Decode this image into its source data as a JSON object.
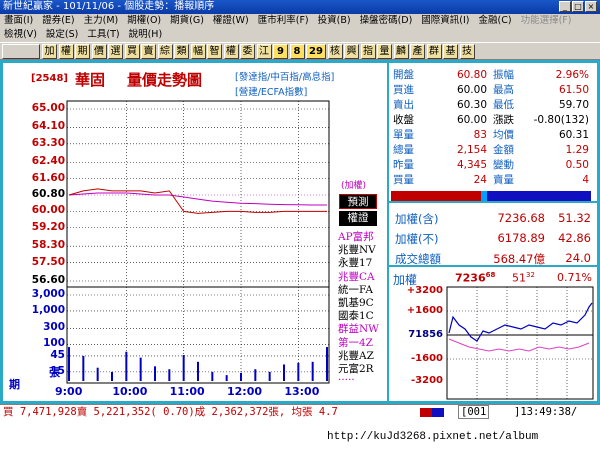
{
  "window": {
    "title": "新世紀贏家 - 101/11/06 - 個股走勢：播報順序"
  },
  "menu_row1": [
    "畫面(I)",
    "證券(E)",
    "主力(M)",
    "期權(O)",
    "期貨(G)",
    "權證(W)",
    "匯市利率(F)",
    "投資(B)",
    "操盤密碼(D)",
    "國際資訊(I)",
    "金融(C)",
    "功能選擇(F)"
  ],
  "menu_row2": [
    "檢視(V)",
    "設定(S)",
    "工具(T)",
    "說明(H)"
  ],
  "toolbar": [
    "加",
    "權",
    "期",
    "價",
    "選",
    "買",
    "賣",
    "綜",
    "類",
    "幅",
    "智",
    "權",
    "委",
    "江",
    "9",
    "8",
    "29",
    "核",
    "興",
    "指",
    "量",
    "麟",
    "產",
    "群",
    "基",
    "技"
  ],
  "stock": {
    "code": "[2548]",
    "name": "華固",
    "chart_title": "量價走勢圖",
    "index_links": "[發達指/中百指/高息指]",
    "index_links2": "[營建/ECFA指數]",
    "reference_tag": "(加權)"
  },
  "price_axis": [
    "65.00",
    "64.10",
    "63.30",
    "62.40",
    "61.60",
    "60.80",
    "60.00",
    "59.20",
    "58.30",
    "57.50",
    "56.60"
  ],
  "volume_axis": [
    "3,000",
    "1,000",
    "300",
    "100",
    "45",
    "15"
  ],
  "volume_label": "張",
  "period_label": "期",
  "time_axis": [
    "9:00",
    "10:00",
    "11:00",
    "12:00",
    "13:00"
  ],
  "legend_buttons": {
    "forecast": "預測",
    "warrant": "權證"
  },
  "brokers": [
    {
      "name": "AP富邦",
      "color": "#c000c0"
    },
    {
      "name": "兆豐NV",
      "color": "#000000"
    },
    {
      "name": "永豐17",
      "color": "#000000"
    },
    {
      "name": "兆豐CA",
      "color": "#c000c0"
    },
    {
      "name": "統一FA",
      "color": "#000000"
    },
    {
      "name": "凱基9C",
      "color": "#000000"
    },
    {
      "name": "國泰1C",
      "color": "#000000"
    },
    {
      "name": "群益NW",
      "color": "#c000c0"
    },
    {
      "name": "第一4Z",
      "color": "#c000c0"
    },
    {
      "name": "兆豐AZ",
      "color": "#000000"
    },
    {
      "name": "元富2R",
      "color": "#000000"
    },
    {
      "name": "·····",
      "color": "#c000c0"
    }
  ],
  "quote": [
    {
      "l1": "開盤",
      "v1": "60.80",
      "l2": "振幅",
      "v2": "2.96%",
      "c1": "#c00000",
      "c2": "#c00000"
    },
    {
      "l1": "買進",
      "v1": "60.00",
      "l2": "最高",
      "v2": "61.50",
      "c1": "#000000",
      "c2": "#c00000"
    },
    {
      "l1": "賣出",
      "v1": "60.30",
      "l2": "最低",
      "v2": "59.70",
      "c1": "#000000",
      "c2": "#000000"
    },
    {
      "l1": "收盤",
      "v1": "60.00",
      "l2": "漲跌",
      "v2": "-0.80(132)",
      "c1": "#000000",
      "c2": "#000000"
    },
    {
      "l1": "單量",
      "v1": "83",
      "l2": "均價",
      "v2": "60.31",
      "c1": "#c00000",
      "c2": "#000000"
    },
    {
      "l1": "總量",
      "v1": "2,154",
      "l2": "金額",
      "v2": "1.29",
      "c1": "#c00000",
      "c2": "#c00000"
    },
    {
      "l1": "昨量",
      "v1": "4,345",
      "l2": "變動",
      "v2": "0.50",
      "c1": "#c00000",
      "c2": "#c00000"
    },
    {
      "l1": "買量",
      "v1": "24",
      "l2": "賣量",
      "v2": "4",
      "c1": "#c00000",
      "c2": "#c00000"
    }
  ],
  "index_stats": [
    {
      "label": "加權(含)",
      "value": "7236.68",
      "change": "51.32"
    },
    {
      "label": "加權(不)",
      "value": "6178.89",
      "change": "42.86"
    },
    {
      "label": "成交總額",
      "value": "568.47億",
      "change": "24.0"
    }
  ],
  "mini": {
    "title": "加權",
    "value": "7236",
    "value_frac": "68",
    "change": "51",
    "change_frac": "32",
    "pct": "0.71%",
    "axis": [
      "+3200",
      "+1600",
      "71856",
      "-1600",
      "-3200"
    ],
    "axis_colors": [
      "#c00000",
      "#c00000",
      "#000080",
      "#c00000",
      "#c00000"
    ]
  },
  "bottom": {
    "summary": "買 7,471,928賣 5,221,352( 0.70)成 2,362,372張, 均張 4.7",
    "code_field": "[001",
    "clock": "]13:49:38/"
  },
  "watermark": "http://kuJd3268.pixnet.net/album",
  "colors": {
    "frame": "#2aa9c9",
    "price_line": "#c00000",
    "avg_line": "#c000c0",
    "volume_bar": "#0000c0",
    "index_line": "#0000c0",
    "pink_line": "#e040c0"
  },
  "chart_data": {
    "type": "line",
    "title": "量價走勢圖",
    "x": [
      "9:00",
      "9:15",
      "9:30",
      "9:45",
      "10:00",
      "10:15",
      "10:30",
      "10:45",
      "11:00",
      "11:15",
      "11:30",
      "11:45",
      "12:00",
      "12:15",
      "12:30",
      "12:45",
      "13:00",
      "13:15",
      "13:30"
    ],
    "series": [
      {
        "name": "price",
        "values": [
          60.8,
          61.0,
          61.1,
          61.0,
          61.0,
          61.0,
          60.9,
          61.0,
          60.0,
          59.9,
          59.95,
          60.0,
          60.0,
          59.95,
          59.95,
          60.0,
          60.0,
          60.0,
          60.0
        ]
      },
      {
        "name": "average",
        "values": [
          60.8,
          60.85,
          60.9,
          60.9,
          60.9,
          60.85,
          60.8,
          60.8,
          60.7,
          60.6,
          60.5,
          60.45,
          60.4,
          60.38,
          60.35,
          60.33,
          60.32,
          60.31,
          60.31
        ]
      },
      {
        "name": "volume",
        "values": [
          83,
          45,
          20,
          15,
          60,
          40,
          22,
          18,
          48,
          30,
          15,
          12,
          14,
          18,
          15,
          25,
          28,
          30,
          83
        ]
      }
    ],
    "ylim": [
      56.6,
      65.0
    ]
  }
}
